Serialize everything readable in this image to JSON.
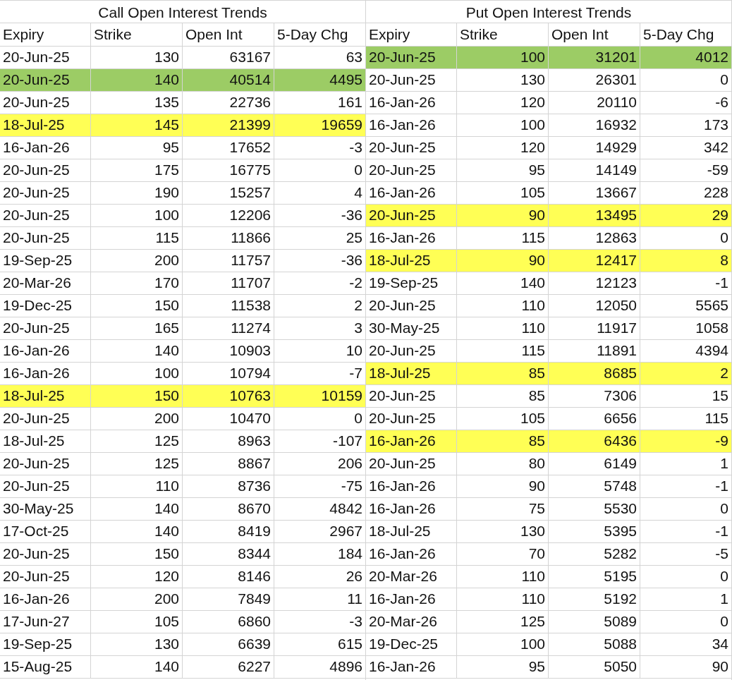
{
  "tables": [
    {
      "title": "Call Open Interest Trends",
      "columns": [
        "Expiry",
        "Strike",
        "Open Int",
        "5-Day Chg"
      ],
      "rows": [
        {
          "cells": [
            "20-Jun-25",
            "130",
            "63167",
            "63"
          ]
        },
        {
          "cells": [
            "20-Jun-25",
            "140",
            "40514",
            "4495"
          ],
          "color": "#9ccc65"
        },
        {
          "cells": [
            "20-Jun-25",
            "135",
            "22736",
            "161"
          ]
        },
        {
          "cells": [
            "18-Jul-25",
            "145",
            "21399",
            "19659"
          ],
          "color": "#ffff55"
        },
        {
          "cells": [
            "16-Jan-26",
            "95",
            "17652",
            "-3"
          ]
        },
        {
          "cells": [
            "20-Jun-25",
            "175",
            "16775",
            "0"
          ]
        },
        {
          "cells": [
            "20-Jun-25",
            "190",
            "15257",
            "4"
          ]
        },
        {
          "cells": [
            "20-Jun-25",
            "100",
            "12206",
            "-36"
          ]
        },
        {
          "cells": [
            "20-Jun-25",
            "115",
            "11866",
            "25"
          ]
        },
        {
          "cells": [
            "19-Sep-25",
            "200",
            "11757",
            "-36"
          ]
        },
        {
          "cells": [
            "20-Mar-26",
            "170",
            "11707",
            "-2"
          ]
        },
        {
          "cells": [
            "19-Dec-25",
            "150",
            "11538",
            "2"
          ]
        },
        {
          "cells": [
            "20-Jun-25",
            "165",
            "11274",
            "3"
          ]
        },
        {
          "cells": [
            "16-Jan-26",
            "140",
            "10903",
            "10"
          ]
        },
        {
          "cells": [
            "16-Jan-26",
            "100",
            "10794",
            "-7"
          ]
        },
        {
          "cells": [
            "18-Jul-25",
            "150",
            "10763",
            "10159"
          ],
          "color": "#ffff55"
        },
        {
          "cells": [
            "20-Jun-25",
            "200",
            "10470",
            "0"
          ]
        },
        {
          "cells": [
            "18-Jul-25",
            "125",
            "8963",
            "-107"
          ]
        },
        {
          "cells": [
            "20-Jun-25",
            "125",
            "8867",
            "206"
          ]
        },
        {
          "cells": [
            "20-Jun-25",
            "110",
            "8736",
            "-75"
          ]
        },
        {
          "cells": [
            "30-May-25",
            "140",
            "8670",
            "4842"
          ]
        },
        {
          "cells": [
            "17-Oct-25",
            "140",
            "8419",
            "2967"
          ]
        },
        {
          "cells": [
            "20-Jun-25",
            "150",
            "8344",
            "184"
          ]
        },
        {
          "cells": [
            "20-Jun-25",
            "120",
            "8146",
            "26"
          ]
        },
        {
          "cells": [
            "16-Jan-26",
            "200",
            "7849",
            "11"
          ]
        },
        {
          "cells": [
            "17-Jun-27",
            "105",
            "6860",
            "-3"
          ]
        },
        {
          "cells": [
            "19-Sep-25",
            "130",
            "6639",
            "615"
          ]
        },
        {
          "cells": [
            "15-Aug-25",
            "140",
            "6227",
            "4896"
          ]
        }
      ]
    },
    {
      "title": "Put Open Interest Trends",
      "columns": [
        "Expiry",
        "Strike",
        "Open Int",
        "5-Day Chg"
      ],
      "rows": [
        {
          "cells": [
            "20-Jun-25",
            "100",
            "31201",
            "4012"
          ],
          "color": "#9ccc65"
        },
        {
          "cells": [
            "20-Jun-25",
            "130",
            "26301",
            "0"
          ]
        },
        {
          "cells": [
            "16-Jan-26",
            "120",
            "20110",
            "-6"
          ]
        },
        {
          "cells": [
            "16-Jan-26",
            "100",
            "16932",
            "173"
          ]
        },
        {
          "cells": [
            "20-Jun-25",
            "120",
            "14929",
            "342"
          ]
        },
        {
          "cells": [
            "20-Jun-25",
            "95",
            "14149",
            "-59"
          ]
        },
        {
          "cells": [
            "16-Jan-26",
            "105",
            "13667",
            "228"
          ]
        },
        {
          "cells": [
            "20-Jun-25",
            "90",
            "13495",
            "29"
          ],
          "color": "#ffff55"
        },
        {
          "cells": [
            "16-Jan-26",
            "115",
            "12863",
            "0"
          ]
        },
        {
          "cells": [
            "18-Jul-25",
            "90",
            "12417",
            "8"
          ],
          "color": "#ffff55"
        },
        {
          "cells": [
            "19-Sep-25",
            "140",
            "12123",
            "-1"
          ]
        },
        {
          "cells": [
            "20-Jun-25",
            "110",
            "12050",
            "5565"
          ]
        },
        {
          "cells": [
            "30-May-25",
            "110",
            "11917",
            "1058"
          ]
        },
        {
          "cells": [
            "20-Jun-25",
            "115",
            "11891",
            "4394"
          ]
        },
        {
          "cells": [
            "18-Jul-25",
            "85",
            "8685",
            "2"
          ],
          "color": "#ffff55"
        },
        {
          "cells": [
            "20-Jun-25",
            "85",
            "7306",
            "15"
          ]
        },
        {
          "cells": [
            "20-Jun-25",
            "105",
            "6656",
            "115"
          ]
        },
        {
          "cells": [
            "16-Jan-26",
            "85",
            "6436",
            "-9"
          ],
          "color": "#ffff55"
        },
        {
          "cells": [
            "20-Jun-25",
            "80",
            "6149",
            "1"
          ]
        },
        {
          "cells": [
            "16-Jan-26",
            "90",
            "5748",
            "-1"
          ]
        },
        {
          "cells": [
            "16-Jan-26",
            "75",
            "5530",
            "0"
          ]
        },
        {
          "cells": [
            "18-Jul-25",
            "130",
            "5395",
            "-1"
          ]
        },
        {
          "cells": [
            "16-Jan-26",
            "70",
            "5282",
            "-5"
          ]
        },
        {
          "cells": [
            "20-Mar-26",
            "110",
            "5195",
            "0"
          ]
        },
        {
          "cells": [
            "16-Jan-26",
            "110",
            "5192",
            "1"
          ]
        },
        {
          "cells": [
            "20-Mar-26",
            "125",
            "5089",
            "0"
          ]
        },
        {
          "cells": [
            "19-Dec-25",
            "100",
            "5088",
            "34"
          ]
        },
        {
          "cells": [
            "16-Jan-26",
            "95",
            "5050",
            "90"
          ]
        }
      ]
    }
  ]
}
